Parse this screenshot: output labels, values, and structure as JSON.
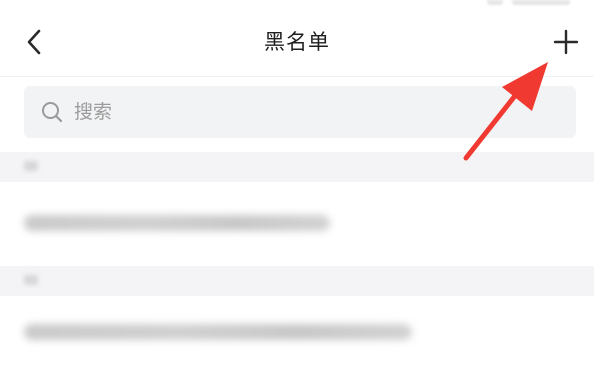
{
  "navbar": {
    "title": "黑名单",
    "back_icon": "chevron-left-icon",
    "add_icon": "plus-icon"
  },
  "search": {
    "placeholder": "搜索",
    "value": "",
    "icon": "search-icon"
  },
  "annotation": {
    "color": "#f03a31",
    "icon": "arrow-icon"
  }
}
